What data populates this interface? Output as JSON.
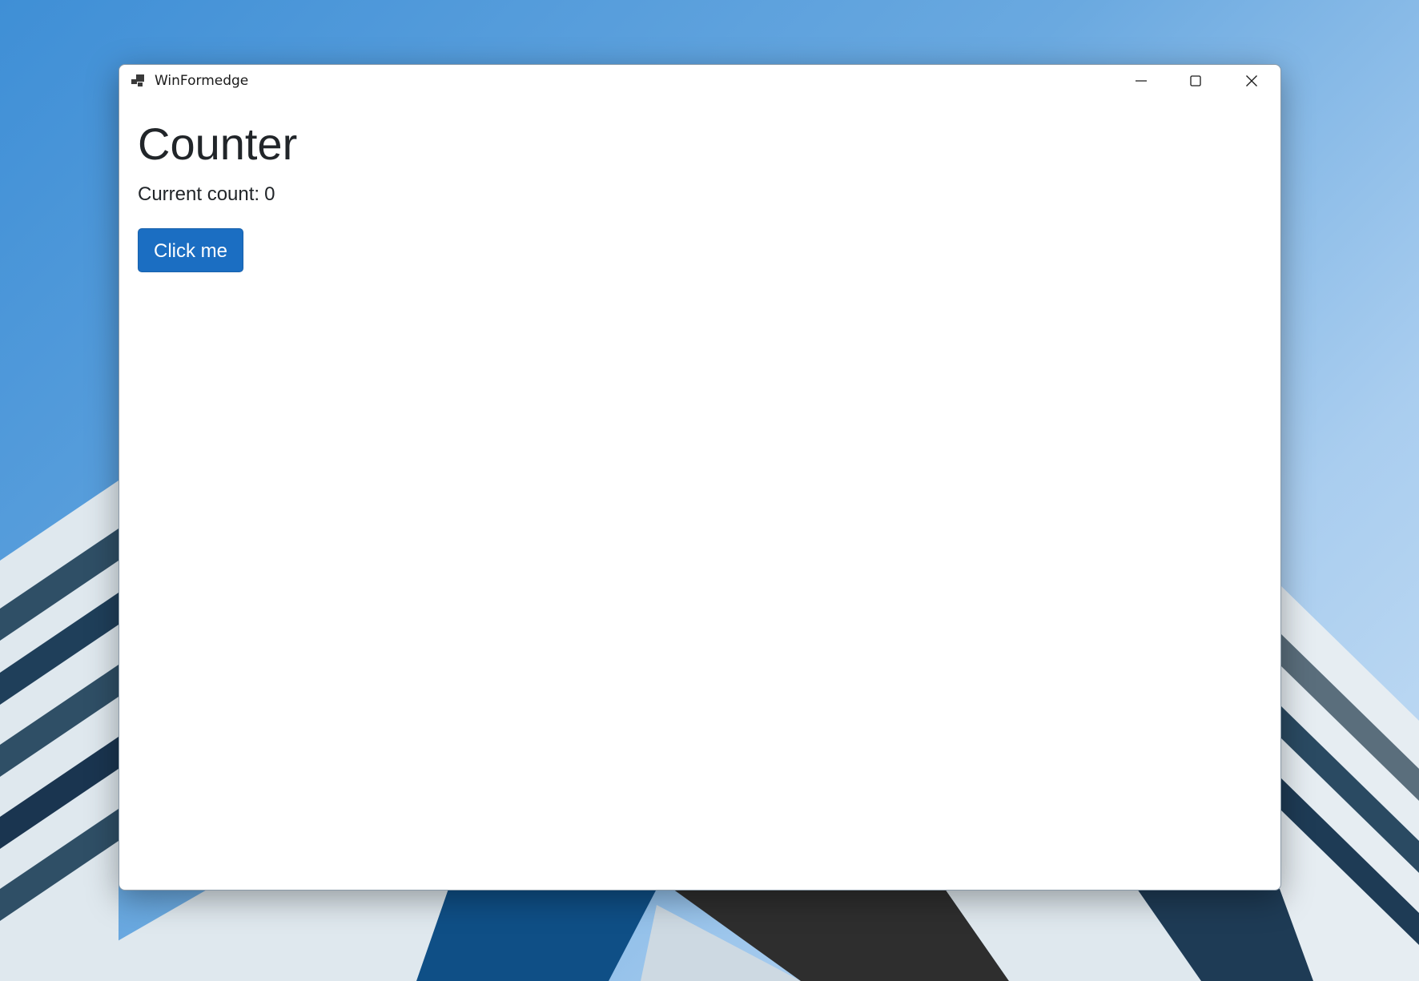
{
  "window": {
    "title": "WinFormedge",
    "controls": {
      "minimize_icon": "minimize-icon",
      "maximize_icon": "maximize-icon",
      "close_icon": "close-icon"
    }
  },
  "page": {
    "title": "Counter",
    "count_label": "Current count:",
    "count_value": "0",
    "button_label": "Click me"
  },
  "colors": {
    "primary_button": "#1b6ec2",
    "text": "#212529",
    "desktop_sky": "#6aa9e0"
  }
}
